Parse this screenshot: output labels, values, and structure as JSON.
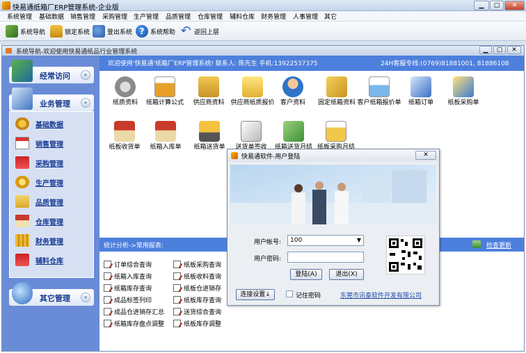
{
  "app": {
    "title": "快易通纸箱厂ERP管理系统-企业版"
  },
  "menu": [
    "系统管理",
    "基础数据",
    "销售管理",
    "采购管理",
    "生产管理",
    "品质管理",
    "仓库管理",
    "辅料仓库",
    "财务管理",
    "人事管理",
    "其它"
  ],
  "toolbar": [
    {
      "label": "系统导航",
      "icon": "book-icon"
    },
    {
      "label": "锁定系统",
      "icon": "lock-icon"
    },
    {
      "label": "登出系统",
      "icon": "users-icon"
    },
    {
      "label": "系统帮助",
      "icon": "help-icon"
    },
    {
      "label": "返回上层",
      "icon": "back-arrow-icon"
    }
  ],
  "child": {
    "title": "系统导航-欢迎使用快易通纸品行业管理系统"
  },
  "sidebar": {
    "frequent": "经常访问",
    "business": "业务管理",
    "items": [
      {
        "label": "基础数据",
        "icon": "gear-icon"
      },
      {
        "label": "销售管理",
        "icon": "calendar-icon"
      },
      {
        "label": "采购管理",
        "icon": "cart-icon"
      },
      {
        "label": "生产管理",
        "icon": "cog-icon"
      },
      {
        "label": "品质管理",
        "icon": "folder-check-icon"
      },
      {
        "label": "仓库管理",
        "icon": "house-icon"
      },
      {
        "label": "财务管理",
        "icon": "coins-icon"
      },
      {
        "label": "辅料仓库",
        "icon": "cart-icon"
      }
    ],
    "other": "其它管理"
  },
  "header": {
    "welcome": "欢迎使用'快易通'纸箱厂ERP管理系统! 联系人: 陈先生  手机:13922537375",
    "hotline": "24H客服专线:(0769)81881001, 81886108"
  },
  "modules": [
    {
      "label": "纸质资料",
      "icon": "gear-icon"
    },
    {
      "label": "纸箱计算公式",
      "icon": "formula-icon"
    },
    {
      "label": "供应商资料",
      "icon": "folder-user-icon"
    },
    {
      "label": "供应商纸质报价",
      "icon": "document-icon"
    },
    {
      "label": "客户资料",
      "icon": "people-icon"
    },
    {
      "label": "固定纸箱资料",
      "icon": "box-icon"
    },
    {
      "label": "客户纸箱报价单",
      "icon": "quote-doc-icon"
    },
    {
      "label": "纸箱订单",
      "icon": "order-icon"
    },
    {
      "label": "纸板采购单",
      "icon": "purchase-icon"
    },
    {
      "label": "纸板收货单",
      "icon": "house-receive-icon"
    },
    {
      "label": "纸箱入库单",
      "icon": "house-in-icon"
    },
    {
      "label": "纸箱送货单",
      "icon": "truck-icon"
    },
    {
      "label": "送货单签收",
      "icon": "sign-icon"
    },
    {
      "label": "纸箱送货月结",
      "icon": "money-icon"
    },
    {
      "label": "纸板采购月结",
      "icon": "report-icon"
    }
  ],
  "stats": {
    "title": "统计分析->常用报表:",
    "refresh": "检查更新"
  },
  "reports": [
    [
      "订单综合查询",
      "纸板采购查询"
    ],
    [
      "纸箱入库查询",
      "纸板收料查询"
    ],
    [
      "纸箱库存查询",
      "纸板仓进销存"
    ],
    [
      "成品标签列印",
      "纸板库存查询"
    ],
    [
      "成品仓进销存汇总",
      "送货综合查询"
    ],
    [
      "纸箱库存盘点调整",
      "纸板库存调整"
    ]
  ],
  "login": {
    "title": "快易通软件-用户登陆",
    "user_label": "用户帐号:",
    "user_value": "100",
    "pass_label": "用户密码:",
    "login_btn": "登陆(A)",
    "exit_btn": "退出(X)",
    "conn_btn": "连接设置↓",
    "remember": "记住密码",
    "company": "东莞市讯泰软件开发有限公司"
  },
  "colors": {
    "sidebar": "#6a8cd6",
    "header": "#4d7fdd",
    "link": "#1a3d94"
  }
}
